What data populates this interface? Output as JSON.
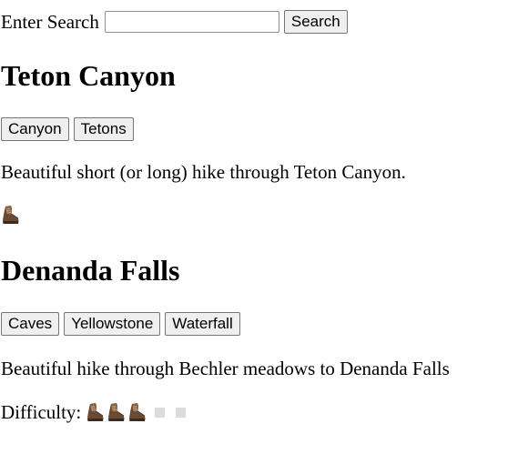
{
  "search": {
    "label": "Enter Search",
    "value": "",
    "placeholder": "",
    "button_label": "Search"
  },
  "trails": [
    {
      "title": "Teton Canyon",
      "tags": [
        "Canyon",
        "Tetons"
      ],
      "description": "Beautiful short (or long) hike through Teton Canyon.",
      "difficulty": 1,
      "difficulty_max": 1
    },
    {
      "title": "Denanda Falls",
      "tags": [
        "Caves",
        "Yellowstone",
        "Waterfall"
      ],
      "description": "Beautiful hike through Bechler meadows to Denanda Falls",
      "difficulty_label": "Difficulty:",
      "difficulty": 3,
      "difficulty_max": 5
    }
  ],
  "icons": {
    "filled_rating": "hiking-boot-icon",
    "empty_rating": "empty-rating-box-icon"
  },
  "colors": {
    "button_bg": "#efefef",
    "empty_rating": "#dcdcdc"
  }
}
